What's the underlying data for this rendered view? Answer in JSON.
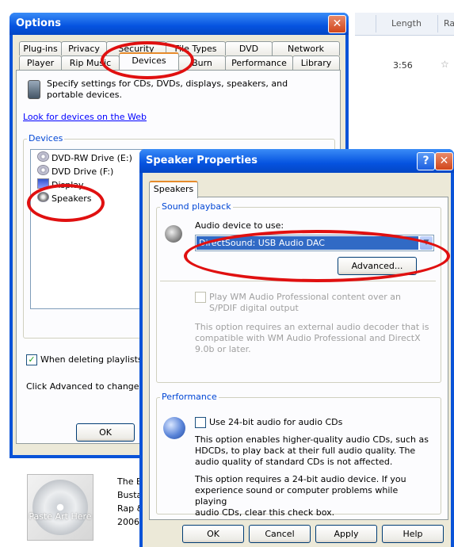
{
  "background": {
    "columns": [
      "Length",
      "Ra"
    ],
    "track_duration": "3:56",
    "album": {
      "art_placeholder": "Paste Art Here",
      "lines": [
        "The Big",
        "Busta R",
        "Rap & h",
        "2006"
      ]
    }
  },
  "options": {
    "title": "Options",
    "tabs_row1": [
      "Plug-ins",
      "Privacy",
      "Security",
      "File Types",
      "DVD",
      "Network"
    ],
    "tabs_row2": [
      "Player",
      "Rip Music",
      "Devices",
      "Burn",
      "Performance",
      "Library"
    ],
    "selected_tab": "Devices",
    "description": "Specify settings for CDs, DVDs, displays, speakers, and portable devices.",
    "link": "Look for devices on the Web",
    "devices_group_label": "Devices",
    "devices": [
      "DVD-RW Drive (E:)",
      "DVD Drive (F:)",
      "Display",
      "Speakers"
    ],
    "checkbox_label": "When deleting playlists fro",
    "advanced_hint": "Click Advanced to change file",
    "ok_label": "OK"
  },
  "speaker": {
    "title": "Speaker Properties",
    "tab_label": "Speakers",
    "sound_playback_label": "Sound playback",
    "audio_device_label": "Audio device to use:",
    "audio_device_value": "DirectSound: USB Audio DAC",
    "advanced_label": "Advanced...",
    "wm_pro_line1": "Play WM Audio Professional content over an",
    "wm_pro_line2": "S/PDIF digital output",
    "wm_pro_note": [
      "This option requires an external audio decoder that is",
      "compatible with WM Audio Professional and DirectX",
      "9.0b or later."
    ],
    "performance_label": "Performance",
    "use24_label": "Use 24-bit audio for audio CDs",
    "perf_note1": [
      "This option enables higher-quality audio CDs, such as",
      "HDCDs, to play back at their full audio quality. The",
      "audio quality of standard CDs is not affected."
    ],
    "perf_note2": [
      "This option requires a 24-bit audio device. If you",
      "experience sound or computer problems while playing",
      "audio CDs, clear this check box."
    ],
    "buttons": {
      "ok": "OK",
      "cancel": "Cancel",
      "apply": "Apply",
      "help": "Help"
    }
  },
  "colors": {
    "annotation": "#e01010",
    "title_bar": "#0553e0",
    "dialog_face": "#ece9d8"
  }
}
